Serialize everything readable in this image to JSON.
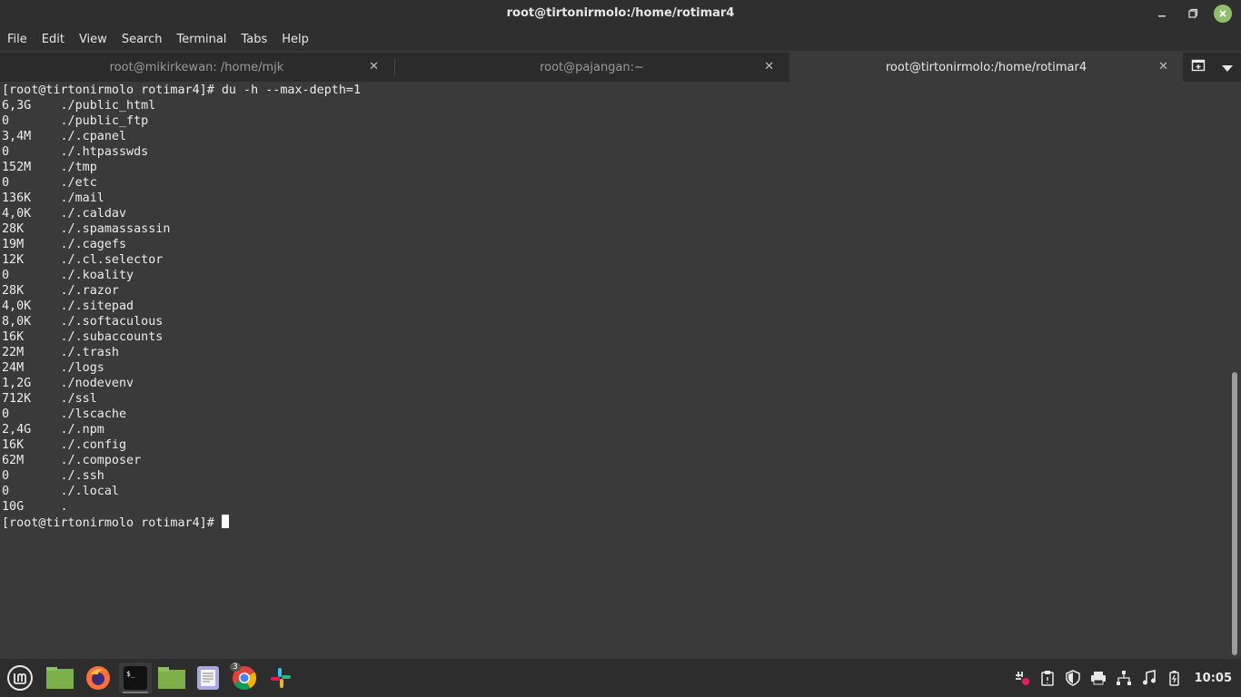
{
  "window": {
    "title": "root@tirtonirmolo:/home/rotimar4",
    "minimize_icon": "minimize-icon",
    "maximize_icon": "maximize-icon",
    "close_icon": "close-icon",
    "close_color": "#8fbf6b"
  },
  "menu": [
    "File",
    "Edit",
    "View",
    "Search",
    "Terminal",
    "Tabs",
    "Help"
  ],
  "tabs": [
    {
      "label": "root@mikirkewan: /home/mjk",
      "active": false
    },
    {
      "label": "root@pajangan:~",
      "active": false
    },
    {
      "label": "root@tirtonirmolo:/home/rotimar4",
      "active": true
    }
  ],
  "tab_tools": {
    "new_tab_icon": "new-tab-icon",
    "menu_icon": "chevron-down-icon"
  },
  "terminal": {
    "lines": [
      "[root@tirtonirmolo rotimar4]# du -h --max-depth=1",
      "6,3G\t./public_html",
      "0\t./public_ftp",
      "3,4M\t./.cpanel",
      "0\t./.htpasswds",
      "152M\t./tmp",
      "0\t./etc",
      "136K\t./mail",
      "4,0K\t./.caldav",
      "28K\t./.spamassassin",
      "19M\t./.cagefs",
      "12K\t./.cl.selector",
      "0\t./.koality",
      "28K\t./.razor",
      "4,0K\t./.sitepad",
      "8,0K\t./.softaculous",
      "16K\t./.subaccounts",
      "22M\t./.trash",
      "24M\t./logs",
      "1,2G\t./nodevenv",
      "712K\t./ssl",
      "0\t./lscache",
      "2,4G\t./.npm",
      "16K\t./.config",
      "62M\t./.composer",
      "0\t./.ssh",
      "0\t./.local",
      "10G\t."
    ],
    "prompt": "[root@tirtonirmolo rotimar4]# "
  },
  "taskbar": {
    "apps": [
      {
        "name": "mint-menu-icon"
      },
      {
        "name": "show-desktop-icon"
      },
      {
        "name": "firefox-icon"
      },
      {
        "name": "terminal-icon",
        "active": true
      },
      {
        "name": "files-icon"
      },
      {
        "name": "text-editor-icon"
      },
      {
        "name": "chrome-icon",
        "badge": "3"
      },
      {
        "name": "slack-icon"
      }
    ],
    "tray": [
      "slack-tray-icon",
      "clipboard-icon",
      "shield-icon",
      "printer-icon",
      "network-icon",
      "music-icon",
      "battery-icon"
    ],
    "clock": "10:05"
  }
}
